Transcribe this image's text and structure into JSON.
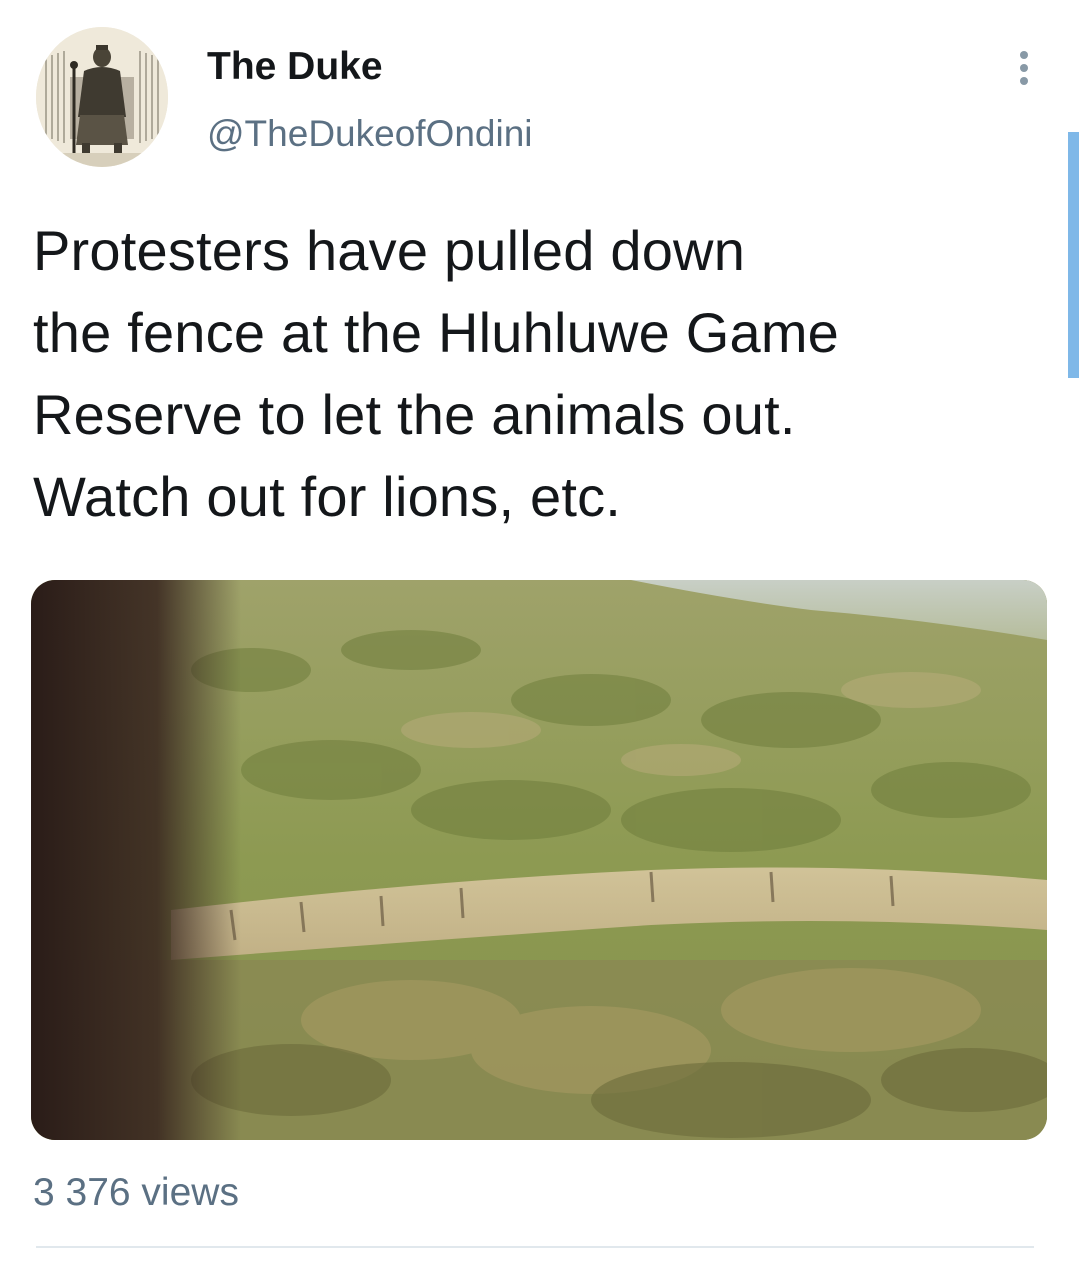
{
  "author": {
    "display_name": "The Duke",
    "handle": "@TheDukeofOndini",
    "avatar_icon": "portrait-engraving"
  },
  "tweet": {
    "text": "Protesters have pulled down\nthe fence at the Hluhluwe Game\nReserve to let the animals out.\nWatch out for lions, etc.",
    "media_type": "video-still"
  },
  "stats": {
    "views": "3 376 views"
  },
  "icons": {
    "more": "more-vertical-icon"
  },
  "colors": {
    "text": "#14171a",
    "secondary": "#5b7083",
    "scroll_indicator": "#7fb8e8",
    "divider": "#e1e8ed"
  }
}
